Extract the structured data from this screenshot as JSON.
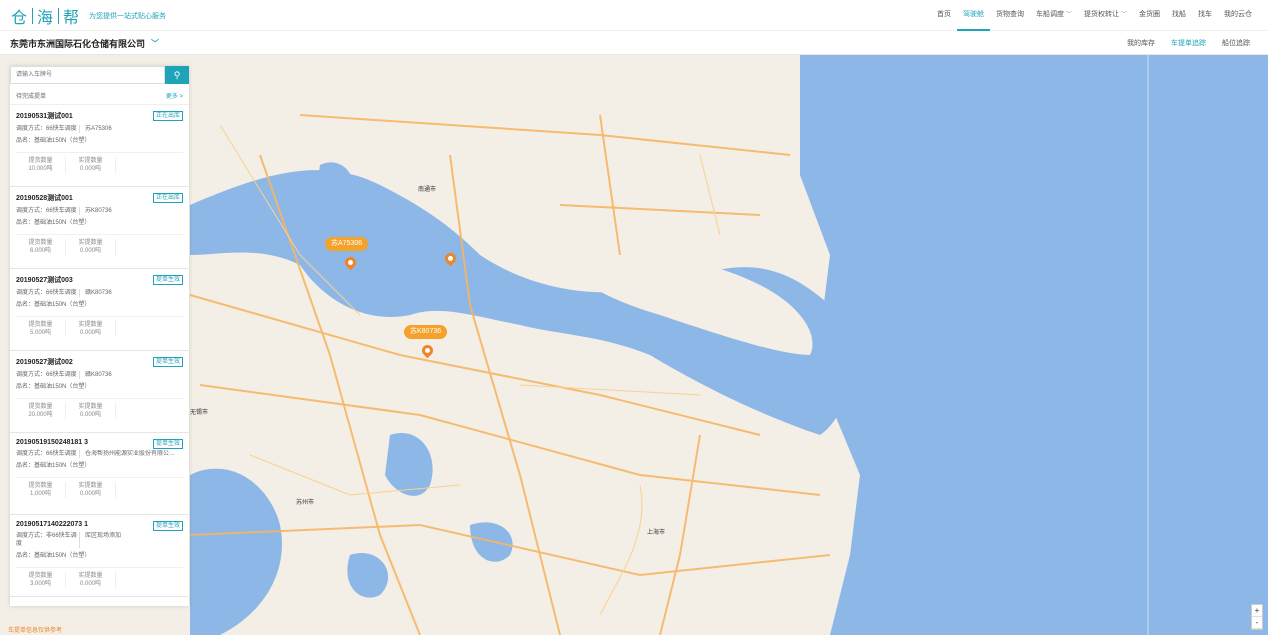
{
  "header": {
    "logo": [
      "仓",
      "海",
      "帮"
    ],
    "slogan": "为您提供一站式贴心服务",
    "nav": [
      {
        "label": "首页",
        "active": false
      },
      {
        "label": "驾驶舱",
        "active": true
      },
      {
        "label": "货物查询",
        "active": false
      },
      {
        "label": "车船调度",
        "active": false,
        "dropdown": true
      },
      {
        "label": "提货权转让",
        "active": false,
        "dropdown": true
      },
      {
        "label": "金货圈",
        "active": false
      },
      {
        "label": "找船",
        "active": false
      },
      {
        "label": "找车",
        "active": false
      },
      {
        "label": "我的云仓",
        "active": false
      }
    ]
  },
  "subbar": {
    "company": "东莞市东洲国际石化仓储有限公司",
    "tabs": [
      {
        "label": "我的库存",
        "active": false
      },
      {
        "label": "车提单追踪",
        "active": true
      },
      {
        "label": "船位追踪",
        "active": false
      }
    ]
  },
  "panel": {
    "search_placeholder": "请输入车牌号",
    "list_title": "待完成提单",
    "more": "更多 >",
    "qty_label": "提货数量",
    "actual_label": "实提数量",
    "orders": [
      {
        "id": "20190531测试001",
        "status": "正在出库",
        "mode": "调度方式：66快车调度",
        "plate": "苏A75306",
        "product": "品名：基础油150N（台塑）",
        "qty": "10.000吨",
        "actual": "0.000吨"
      },
      {
        "id": "20190528测试001",
        "status": "正在出库",
        "mode": "调度方式：66快车调度",
        "plate": "苏K80736",
        "product": "品名：基础油150N（台塑）",
        "qty": "6.000吨",
        "actual": "0.000吨"
      },
      {
        "id": "20190527测试003",
        "status": "提单生效",
        "mode": "调度方式：66快车调度",
        "plate": "赣K80736",
        "product": "品名：基础油150N（台塑）",
        "qty": "5.000吨",
        "actual": "0.000吨"
      },
      {
        "id": "20190527测试002",
        "status": "提单生效",
        "mode": "调度方式：66快车调度",
        "plate": "赣K80736",
        "product": "品名：基础油150N（台塑）",
        "qty": "20.000吨",
        "actual": "0.000吨"
      },
      {
        "id": "20190519150248181 3",
        "status": "提单生效",
        "mode": "调度方式：66快车调度",
        "plate": "仓海帮扬州能源实业股份有限公司…",
        "product": "品名：基础油150N（台塑）",
        "qty": "1.000吨",
        "actual": "0.000吨"
      },
      {
        "id": "20190517140222073 1",
        "status": "提单生效",
        "mode": "调度方式：非66快车调度",
        "plate": "库区现场添加",
        "product": "品名：基础油150N（台塑）",
        "qty": "3.000吨",
        "actual": "0.000吨"
      }
    ]
  },
  "map": {
    "markers": [
      {
        "label": "苏A75306"
      },
      {
        "label": "苏K80736"
      }
    ],
    "cities": [
      "南通市",
      "无锡市",
      "苏州市",
      "上海市"
    ],
    "zoom_in": "+",
    "zoom_out": "-",
    "footer": "车提单信息仅供参考"
  },
  "colors": {
    "accent": "#1fa3b8",
    "marker": "#f4a22a",
    "water": "#8db7e6",
    "land": "#f3efe6",
    "road": "#f7b564"
  }
}
